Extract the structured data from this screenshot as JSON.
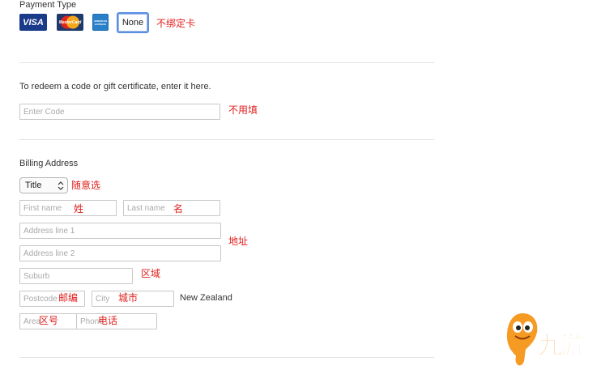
{
  "payment": {
    "title": "Payment Type",
    "cards": {
      "visa": "VISA",
      "mastercard": "MasterCard",
      "amex": "AMERICAN EXPRESS",
      "none": "None"
    },
    "note": "不绑定卡"
  },
  "redeem": {
    "instruction": "To redeem a code or gift certificate, enter it here.",
    "code_placeholder": "Enter Code",
    "note": "不用填"
  },
  "billing": {
    "title": "Billing Address",
    "title_select": "Title",
    "title_note": "随意选",
    "first_name_placeholder": "First name",
    "first_name_note": "姓",
    "last_name_placeholder": "Last name",
    "last_name_note": "名",
    "address1_placeholder": "Address line 1",
    "address2_placeholder": "Address line 2",
    "address_note": "地址",
    "suburb_placeholder": "Suburb",
    "suburb_note": "区域",
    "postcode_placeholder": "Postcode",
    "postcode_note": "邮编",
    "city_placeholder": "City",
    "city_note": "城市",
    "country": "New Zealand",
    "area_placeholder": "Area",
    "area_note": "区号",
    "phone_placeholder": "Phone",
    "phone_note": "电话"
  },
  "watermark": {
    "text": "九游"
  }
}
